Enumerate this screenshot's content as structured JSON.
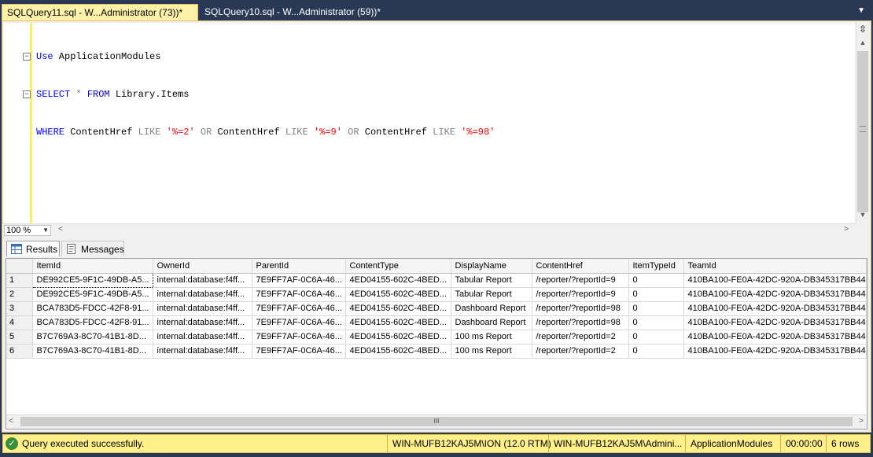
{
  "tabs": [
    {
      "label": "SQLQuery11.sql - W...Administrator (73))*",
      "active": true
    },
    {
      "label": "SQLQuery10.sql - W...Administrator (59))*",
      "active": false
    }
  ],
  "editor": {
    "lines": {
      "l1_kw": "Use",
      "l1_rest": " ApplicationModules",
      "l2_kw": "SELECT",
      "l2_star": " * ",
      "l2_from": "FROM",
      "l2_rest": " Library.Items",
      "l3_where": "WHERE",
      "l3_col1": " ContentHref ",
      "l3_like1": "LIKE",
      "l3_str1": " '%=2'",
      "l3_or1": " OR",
      "l3_col2": " ContentHref ",
      "l3_like2": "LIKE",
      "l3_str2": " '%=9'",
      "l3_or2": " OR",
      "l3_col3": " ContentHref ",
      "l3_like3": "LIKE",
      "l3_str3": " '%=98'"
    },
    "zoom": "100 %"
  },
  "result_tabs": {
    "results": "Results",
    "messages": "Messages"
  },
  "grid": {
    "columns": [
      "ItemId",
      "OwnerId",
      "ParentId",
      "ContentType",
      "DisplayName",
      "ContentHref",
      "ItemTypeId",
      "TeamId"
    ],
    "rows": [
      {
        "n": "1",
        "cells": [
          "DE992CE5-9F1C-49DB-A5...",
          "internal:database:f4ff...",
          "7E9FF7AF-0C6A-46...",
          "4ED04155-602C-4BED...",
          "Tabular Report",
          "/reporter/?reportId=9",
          "0",
          "410BA100-FE0A-42DC-920A-DB345317BB44"
        ]
      },
      {
        "n": "2",
        "cells": [
          "DE992CE5-9F1C-49DB-A5...",
          "internal:database:f4ff...",
          "7E9FF7AF-0C6A-46...",
          "4ED04155-602C-4BED...",
          "Tabular Report",
          "/reporter/?reportId=9",
          "0",
          "410BA100-FE0A-42DC-920A-DB345317BB44"
        ]
      },
      {
        "n": "3",
        "cells": [
          "BCA783D5-FDCC-42F8-91...",
          "internal:database:f4ff...",
          "7E9FF7AF-0C6A-46...",
          "4ED04155-602C-4BED...",
          "Dashboard Report",
          "/reporter/?reportId=98",
          "0",
          "410BA100-FE0A-42DC-920A-DB345317BB44"
        ]
      },
      {
        "n": "4",
        "cells": [
          "BCA783D5-FDCC-42F8-91...",
          "internal:database:f4ff...",
          "7E9FF7AF-0C6A-46...",
          "4ED04155-602C-4BED...",
          "Dashboard Report",
          "/reporter/?reportId=98",
          "0",
          "410BA100-FE0A-42DC-920A-DB345317BB44"
        ]
      },
      {
        "n": "5",
        "cells": [
          "B7C769A3-8C70-41B1-8D...",
          "internal:database:f4ff...",
          "7E9FF7AF-0C6A-46...",
          "4ED04155-602C-4BED...",
          "100 ms Report",
          "/reporter/?reportId=2",
          "0",
          "410BA100-FE0A-42DC-920A-DB345317BB44"
        ]
      },
      {
        "n": "6",
        "cells": [
          "B7C769A3-8C70-41B1-8D...",
          "internal:database:f4ff...",
          "7E9FF7AF-0C6A-46...",
          "4ED04155-602C-4BED...",
          "100 ms Report",
          "/reporter/?reportId=2",
          "0",
          "410BA100-FE0A-42DC-920A-DB345317BB44"
        ]
      }
    ],
    "scroll_thumb_glyph": "III"
  },
  "status": {
    "message": "Query executed successfully.",
    "server": "WIN-MUFB12KAJ5M\\ION (12.0 RTM)",
    "user": "WIN-MUFB12KAJ5M\\Admini...",
    "database": "ApplicationModules",
    "elapsed": "00:00:00",
    "rows": "6 rows"
  },
  "colors": {
    "chrome": "#293955",
    "active_tab": "#fff1a8",
    "status_bar": "#fff08a",
    "success": "#3a8f3a",
    "keyword": "#0000ff",
    "string": "#ff0000"
  },
  "icons": [
    "split-icon",
    "results-grid-icon",
    "messages-icon",
    "success-check-icon"
  ]
}
